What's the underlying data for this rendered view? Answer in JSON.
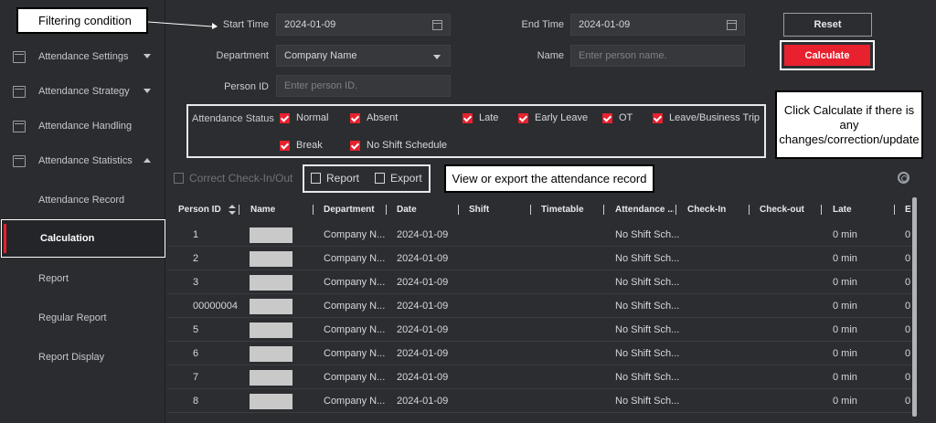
{
  "sidebar": {
    "items": [
      {
        "label": "Attendance Settings",
        "icon": "calendar-icon",
        "expand": "down"
      },
      {
        "label": "Attendance Strategy",
        "icon": "calendar-icon",
        "expand": "down"
      },
      {
        "label": "Attendance Handling",
        "icon": "check-calendar-icon",
        "expand": ""
      },
      {
        "label": "Attendance Statistics",
        "icon": "statistics-icon",
        "expand": "up"
      }
    ],
    "sub_items": [
      {
        "label": "Attendance Record"
      },
      {
        "label": "Calculation"
      },
      {
        "label": "Report"
      },
      {
        "label": "Regular Report"
      },
      {
        "label": "Report Display"
      }
    ]
  },
  "filters": {
    "start_time_label": "Start Time",
    "start_time_value": "2024-01-09",
    "end_time_label": "End Time",
    "end_time_value": "2024-01-09",
    "department_label": "Department",
    "department_value": "Company Name",
    "name_label": "Name",
    "name_placeholder": "Enter person name.",
    "person_id_label": "Person ID",
    "person_id_placeholder": "Enter person ID.",
    "status_label": "Attendance Status",
    "statuses": [
      "Normal",
      "Absent",
      "Late",
      "Early Leave",
      "OT",
      "Leave/Business Trip",
      "Break",
      "No Shift Schedule"
    ]
  },
  "buttons": {
    "reset": "Reset",
    "calculate": "Calculate"
  },
  "toolbar": {
    "correct": "Correct Check-In/Out",
    "report": "Report",
    "export": "Export"
  },
  "callouts": {
    "filtering": "Filtering condition",
    "calculate_hint": "Click Calculate if there is any changes/correction/update",
    "view_export": "View or export the attendance record"
  },
  "table": {
    "columns": [
      "Person ID",
      "Name",
      "Department",
      "Date",
      "Shift",
      "Timetable",
      "Attendance ...",
      "Check-In",
      "Check-out",
      "Late",
      "E"
    ],
    "rows": [
      {
        "id": "1",
        "department": "Company N...",
        "date": "2024-01-09",
        "attendance": "No Shift Sch...",
        "late": "0 min",
        "early": "0"
      },
      {
        "id": "2",
        "department": "Company N...",
        "date": "2024-01-09",
        "attendance": "No Shift Sch...",
        "late": "0 min",
        "early": "0"
      },
      {
        "id": "3",
        "department": "Company N...",
        "date": "2024-01-09",
        "attendance": "No Shift Sch...",
        "late": "0 min",
        "early": "0"
      },
      {
        "id": "00000004",
        "department": "Company N...",
        "date": "2024-01-09",
        "attendance": "No Shift Sch...",
        "late": "0 min",
        "early": "0"
      },
      {
        "id": "5",
        "department": "Company N...",
        "date": "2024-01-09",
        "attendance": "No Shift Sch...",
        "late": "0 min",
        "early": "0"
      },
      {
        "id": "6",
        "department": "Company N...",
        "date": "2024-01-09",
        "attendance": "No Shift Sch...",
        "late": "0 min",
        "early": "0"
      },
      {
        "id": "7",
        "department": "Company N...",
        "date": "2024-01-09",
        "attendance": "No Shift Sch...",
        "late": "0 min",
        "early": "0"
      },
      {
        "id": "8",
        "department": "Company N...",
        "date": "2024-01-09",
        "attendance": "No Shift Sch...",
        "late": "0 min",
        "early": "0"
      }
    ]
  },
  "colors": {
    "accent": "#e8212e",
    "background": "#2b2d30"
  }
}
